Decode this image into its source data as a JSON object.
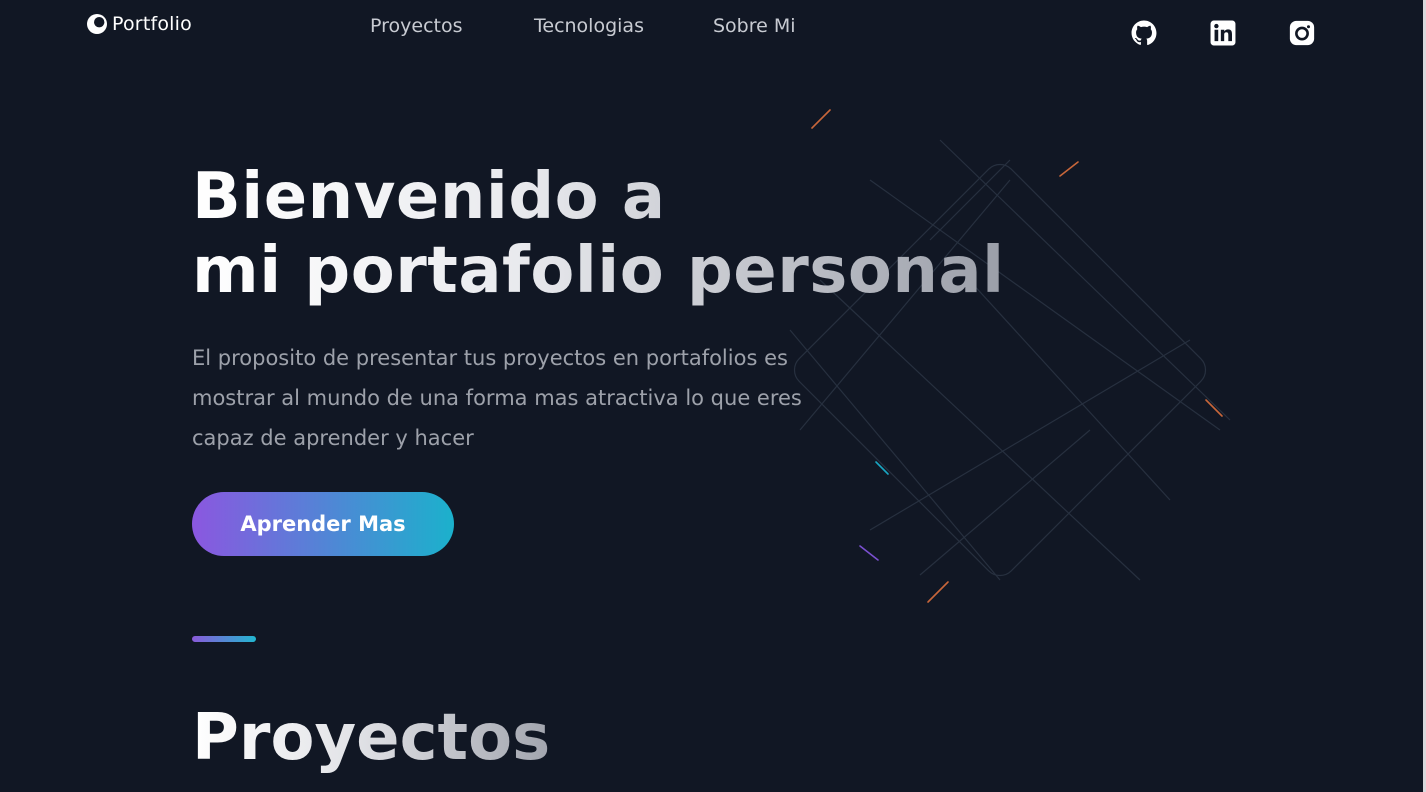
{
  "header": {
    "logo_text": "Portfolio",
    "nav": [
      {
        "label": "Proyectos"
      },
      {
        "label": "Tecnologias"
      },
      {
        "label": "Sobre Mi"
      }
    ],
    "social": [
      {
        "icon": "github-icon"
      },
      {
        "icon": "linkedin-icon"
      },
      {
        "icon": "instagram-icon"
      }
    ]
  },
  "hero": {
    "title_line1": "Bienvenido a",
    "title_line2": "mi portafolio personal",
    "description_lines": [
      "El proposito de presentar tus proyectos en portafolios es",
      "mostrar al mundo de una forma mas atractiva lo que eres",
      "capaz de aprender y hacer"
    ],
    "cta_label": "Aprender Mas"
  },
  "section": {
    "title": "Proyectos"
  },
  "colors": {
    "background": "#111724",
    "accent_start": "#8b57e0",
    "accent_end": "#1bb1cc",
    "nav_text": "#c8cbd2",
    "body_text": "#9da1aa"
  }
}
